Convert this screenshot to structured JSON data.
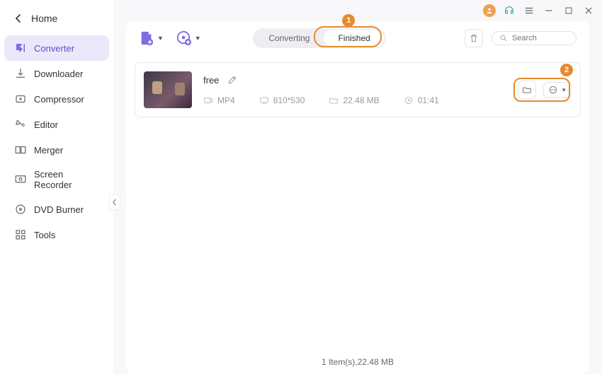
{
  "home": {
    "label": "Home"
  },
  "sidebar": {
    "items": [
      {
        "label": "Converter"
      },
      {
        "label": "Downloader"
      },
      {
        "label": "Compressor"
      },
      {
        "label": "Editor"
      },
      {
        "label": "Merger"
      },
      {
        "label": "Screen Recorder"
      },
      {
        "label": "DVD Burner"
      },
      {
        "label": "Tools"
      }
    ]
  },
  "tabs": {
    "converting": "Converting",
    "finished": "Finished"
  },
  "search": {
    "placeholder": "Search"
  },
  "callouts": {
    "one": "1",
    "two": "2"
  },
  "file": {
    "title": "free",
    "format": "MP4",
    "resolution": "810*530",
    "size": "22.48 MB",
    "duration": "01:41"
  },
  "footer": {
    "text": "1 Item(s),22.48 MB"
  }
}
